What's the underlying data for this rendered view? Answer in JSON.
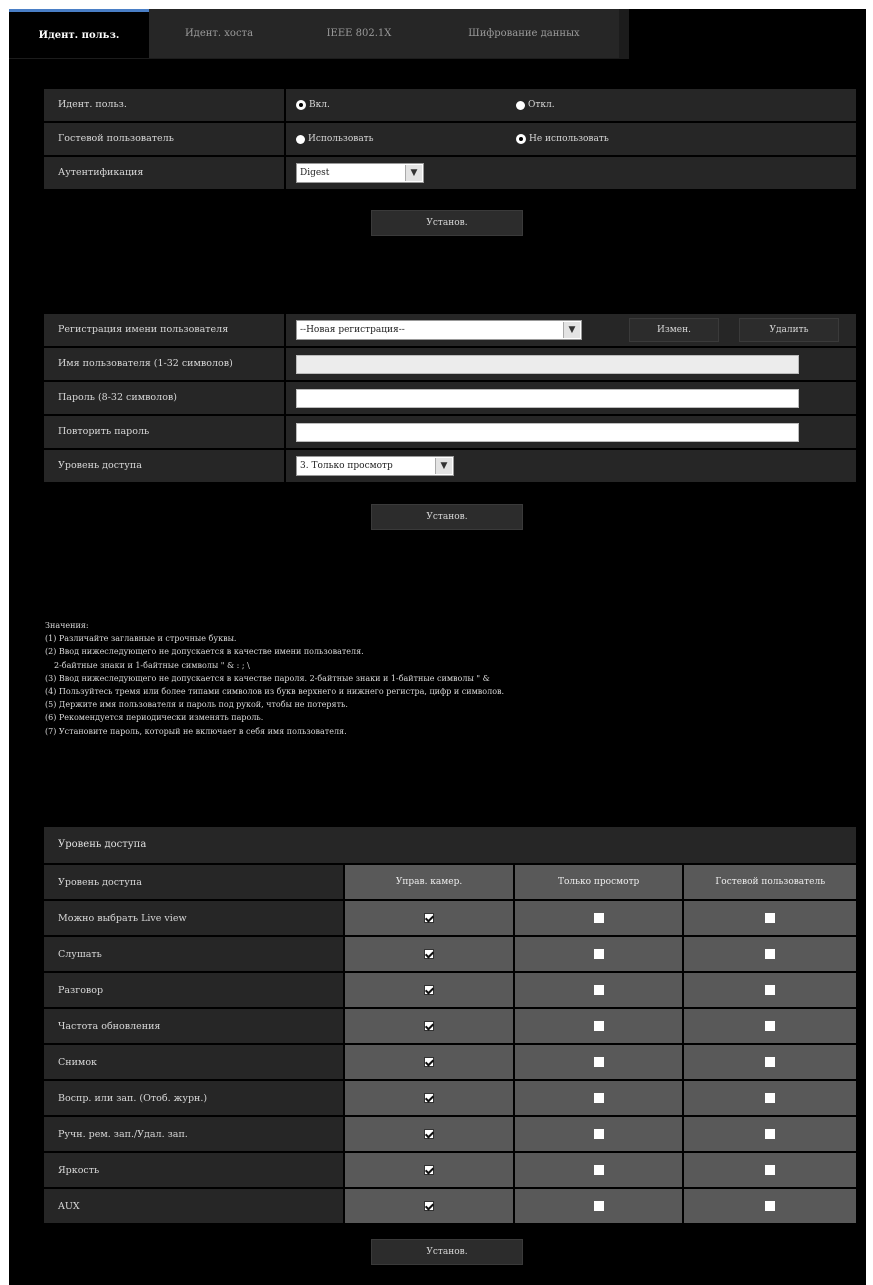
{
  "tabs": [
    {
      "label": "Идент. польз.",
      "active": true
    },
    {
      "label": "Идент. хоста",
      "active": false
    },
    {
      "label": "IEEE 802.1X",
      "active": false
    },
    {
      "label": "Шифрование данных",
      "active": false
    }
  ],
  "auth_section": {
    "user_auth": {
      "label": "Идент. польз.",
      "on": "Вкл.",
      "off": "Откл.",
      "selected": "on"
    },
    "guest_user": {
      "label": "Гостевой пользователь",
      "use": "Использовать",
      "not_use": "Не использовать",
      "selected": "not_use"
    },
    "authentication": {
      "label": "Аутентификация",
      "value": "Digest"
    },
    "set_button": "Установ."
  },
  "user_section": {
    "registration": {
      "label": "Регистрация имени пользователя",
      "value": "--Новая регистрация--",
      "change_button": "Измен.",
      "delete_button": "Удалить"
    },
    "username": {
      "label": "Имя пользователя (1-32 символов)",
      "value": ""
    },
    "password": {
      "label": "Пароль (8-32 символов)",
      "value": ""
    },
    "retype": {
      "label": "Повторить пароль",
      "value": ""
    },
    "access_level": {
      "label": "Уровень доступа",
      "value": "3. Только просмотр"
    },
    "set_button": "Установ."
  },
  "notes": {
    "title": "Значения:",
    "lines": [
      "(1) Различайте заглавные и строчные буквы.",
      "(2) Ввод нижеследующего не допускается в качестве имени пользователя.",
      "2-байтные знаки и 1-байтные символы \" & : ; \\",
      "(3) Ввод нижеследующего не допускается в качестве пароля.   2-байтные знаки и 1-байтные символы \" &",
      "(4) Пользуйтесь тремя или более типами символов из букв верхнего и нижнего регистра, цифр и символов.",
      "(5) Держите имя пользователя и пароль под рукой, чтобы не потерять.",
      "(6) Рекомендуется периодически изменять пароль.",
      "(7) Установите пароль, который не включает в себя имя пользователя."
    ]
  },
  "access_table": {
    "title": "Уровень доступа",
    "header": [
      "Уровень доступа",
      "Управ. камер.",
      "Только просмотр",
      "Гостевой пользователь"
    ],
    "rows": [
      {
        "name": "Можно выбрать Live view",
        "checks": [
          true,
          false,
          false
        ]
      },
      {
        "name": "Слушать",
        "checks": [
          true,
          false,
          false
        ]
      },
      {
        "name": "Разговор",
        "checks": [
          true,
          false,
          false
        ]
      },
      {
        "name": "Частота обновления",
        "checks": [
          true,
          false,
          false
        ]
      },
      {
        "name": "Снимок",
        "checks": [
          true,
          false,
          false
        ]
      },
      {
        "name": "Воспр. или зап. (Отоб. журн.)",
        "checks": [
          true,
          false,
          false
        ]
      },
      {
        "name": "Ручн. рем. зап./Удал. зап.",
        "checks": [
          true,
          false,
          false
        ]
      },
      {
        "name": "Яркость",
        "checks": [
          true,
          false,
          false
        ]
      },
      {
        "name": "AUX",
        "checks": [
          true,
          false,
          false
        ]
      }
    ],
    "set_button": "Установ."
  }
}
